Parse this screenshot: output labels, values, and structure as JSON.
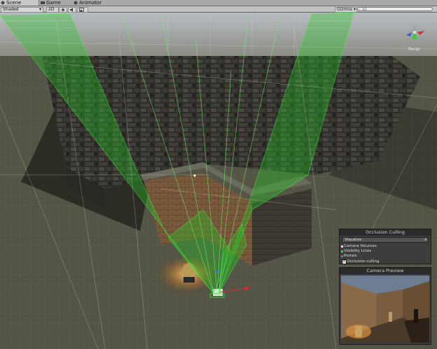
{
  "tabs": [
    {
      "label": "Scene",
      "icon": "scene-icon"
    },
    {
      "label": "Game",
      "icon": "game-icon"
    },
    {
      "label": "Animator",
      "icon": "animator-icon"
    }
  ],
  "toolbar": {
    "shading_mode": "Shaded",
    "mode_2d": "2D",
    "light_icon": "sun-icon",
    "audio_icon": "speaker-icon",
    "effects_icon": "image-icon",
    "gizmos_label": "Gizmos",
    "search_placeholder": "All"
  },
  "gizmo": {
    "projection": "Persp"
  },
  "occlusion_panel": {
    "title": "Occlusion Culling",
    "dropdown_value": "Visualize",
    "legend": [
      {
        "label": "Camera Volumes",
        "color": "#e0e0e0"
      },
      {
        "label": "Visibility Lines",
        "color": "#35d035"
      },
      {
        "label": "Portals",
        "color": "#4a7ae0"
      }
    ],
    "checkbox_label": "Occlusion culling",
    "checked": true
  },
  "camera_preview": {
    "title": "Camera Preview"
  },
  "colors": {
    "visibility": "#22cc22",
    "grid": "#6b6b4a",
    "panel": "#3d3d3d"
  }
}
